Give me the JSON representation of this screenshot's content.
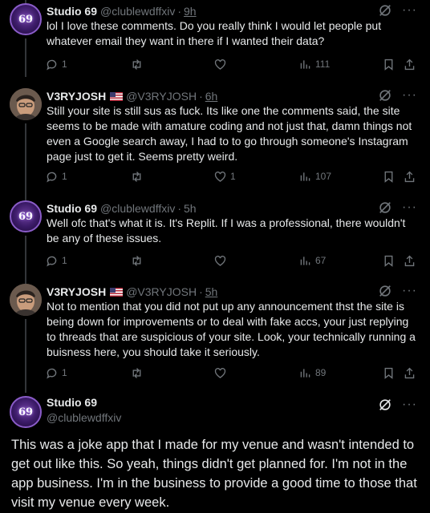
{
  "replies": [
    {
      "name": "Studio 69",
      "handle": "@clublewdffxiv",
      "time": "9h",
      "avatar_text": "69",
      "text": "lol I love these comments. Do you really think I would let people put whatever email they want in there if I wanted their data?",
      "replies_count": "1",
      "retweets": "",
      "likes": "",
      "views": "111"
    },
    {
      "name": "V3RYJOSH",
      "handle": "@V3RYJOSH",
      "time": "6h",
      "text": "Still your site is still sus as fuck. Its like one the comments said, the site seems to be made with amature coding and not just that, damn things not even a Google search away, I had to to go through someone's Instagram page just to get it. Seems pretty weird.",
      "replies_count": "1",
      "retweets": "",
      "likes": "1",
      "views": "107"
    },
    {
      "name": "Studio 69",
      "handle": "@clublewdffxiv",
      "time": "5h",
      "avatar_text": "69",
      "text": "Well ofc that's what it is. It's Replit. If I was a professional, there wouldn't be any of these issues.",
      "replies_count": "1",
      "retweets": "",
      "likes": "",
      "views": "67"
    },
    {
      "name": "V3RYJOSH",
      "handle": "@V3RYJOSH",
      "time": "5h",
      "text": "Not to mention that you did not put up any announcement thst the site is being down for improvements or to deal with fake accs, your just replying to threads that are suspicious of your site. Look, your technically running a buisness here, you should take it seriously.",
      "replies_count": "1",
      "retweets": "",
      "likes": "",
      "views": "89"
    }
  ],
  "main_post": {
    "name": "Studio 69",
    "handle": "@clublewdffxiv",
    "avatar_text": "69",
    "text": "This was a joke app that I made for my venue and wasn't intended to get out like this. So yeah, things didn't get planned for. I'm not in the app business. I'm in the business to provide a good time to those that visit my venue every week."
  },
  "ui": {
    "dot": "·",
    "more": "···"
  }
}
